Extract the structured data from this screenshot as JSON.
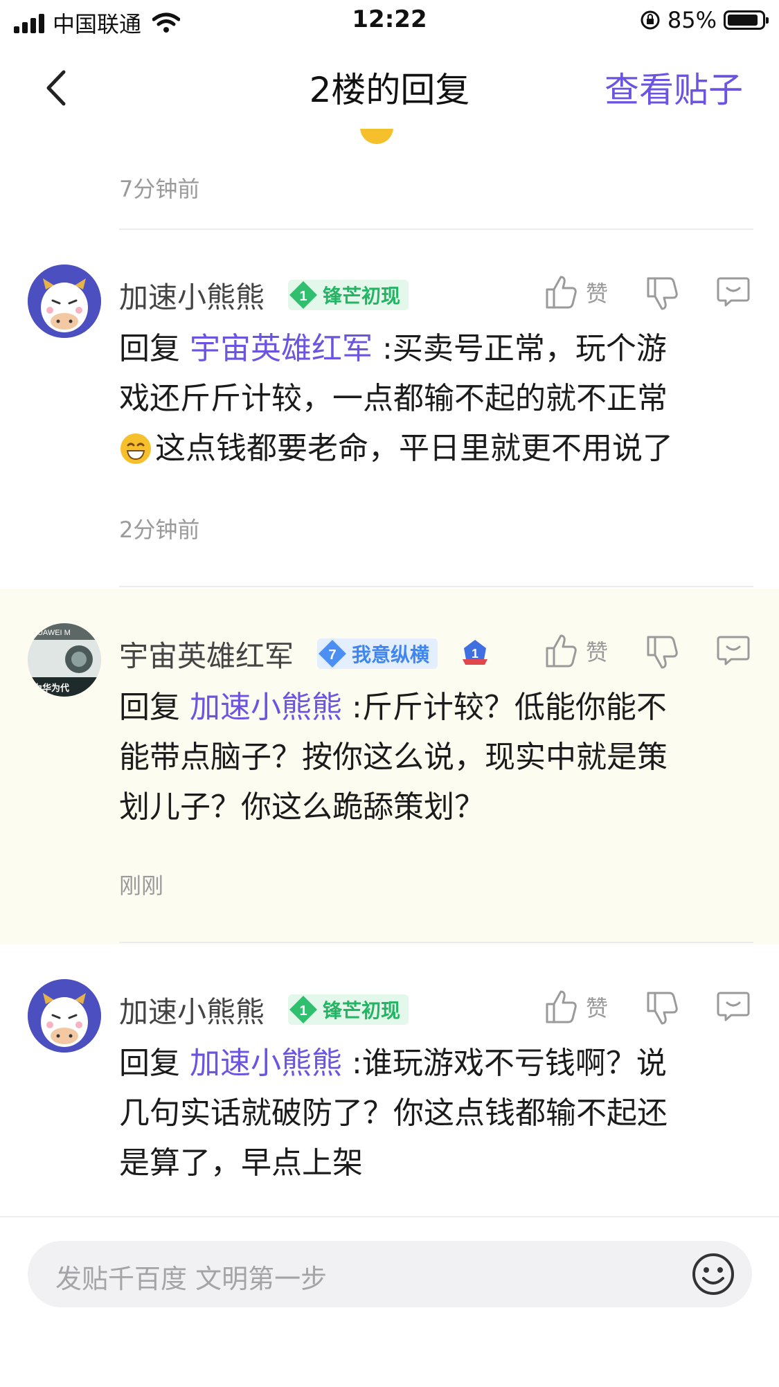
{
  "status_bar": {
    "carrier": "中国联通",
    "time": "12:22",
    "battery": "85%"
  },
  "nav": {
    "title": "2楼的回复",
    "action": "查看贴子"
  },
  "partial_post": {
    "time": "7分钟前"
  },
  "posts": [
    {
      "username": "加速小熊熊",
      "badge_level": "1",
      "badge_text": "锋芒初现",
      "reply_prefix": "回复",
      "mention": "宇宙英雄红军",
      "text_line1": ":买卖号正常，玩个游",
      "text_line2": "戏还斤斤计较，一点都输不起的就不正常",
      "text_line3": "这点钱都要老命，平日里就更不用说了",
      "time": "2分钟前",
      "like_label": "赞"
    },
    {
      "username": "宇宙英雄红军",
      "badge_level": "7",
      "badge_text": "我意纵横",
      "rank_number": "1",
      "avatar_text_top": "HUAWEI M",
      "avatar_text_bottom": "为华为代",
      "reply_prefix": "回复",
      "mention": "加速小熊熊",
      "text_line1": ":斤斤计较？低能你能不",
      "text_line2": "能带点脑子？按你这么说，现实中就是策",
      "text_line3": "划儿子？你这么跪舔策划？",
      "time": "刚刚",
      "like_label": "赞"
    },
    {
      "username": "加速小熊熊",
      "badge_level": "1",
      "badge_text": "锋芒初现",
      "reply_prefix": "回复",
      "mention": "加速小熊熊",
      "text_line1": ":谁玩游戏不亏钱啊？说",
      "text_line2": "几句实话就破防了？你这点钱都输不起还",
      "text_line3": "是算了，早点上架",
      "like_label": "赞"
    }
  ],
  "input": {
    "placeholder": "发贴千百度 文明第一步"
  },
  "colors": {
    "accent": "#6b55e0",
    "badge_green": "#23b464",
    "badge_blue": "#3f86f0",
    "highlight_bg": "#fdfcf0"
  }
}
